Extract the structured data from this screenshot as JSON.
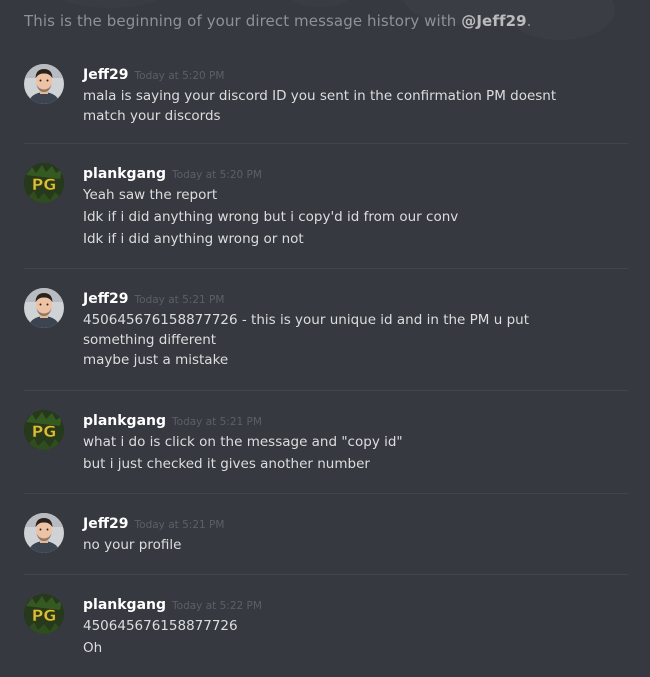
{
  "intro": {
    "prefix": "This is the beginning of your direct message history with ",
    "username": "@Jeff29",
    "suffix": "."
  },
  "messages": [
    {
      "author": "Jeff29",
      "time": "Today at 5:20 PM",
      "avatar": "jeff-avatar",
      "lines": [
        "mala is saying your discord ID you sent in the confirmation PM doesnt match your discords"
      ]
    },
    {
      "author": "plankgang",
      "time": "Today at 5:20 PM",
      "avatar": "pg-avatar",
      "avatar_text": "PG",
      "lines": [
        "Yeah saw the report",
        "Idk if i did anything wrong but i copy'd id from our conv",
        "Idk if i did anything wrong or not"
      ]
    },
    {
      "author": "Jeff29",
      "time": "Today at 5:21 PM",
      "avatar": "jeff-avatar",
      "lines": [
        "450645676158877726 - this is your unique id and in the PM u put something different",
        "maybe just a mistake"
      ]
    },
    {
      "author": "plankgang",
      "time": "Today at 5:21 PM",
      "avatar": "pg-avatar",
      "avatar_text": "PG",
      "lines": [
        "what i do is click on the message and \"copy id\"",
        "but i just checked it gives another number"
      ]
    },
    {
      "author": "Jeff29",
      "time": "Today at 5:21 PM",
      "avatar": "jeff-avatar",
      "lines": [
        "no your profile"
      ]
    },
    {
      "author": "plankgang",
      "time": "Today at 5:22 PM",
      "avatar": "pg-avatar",
      "avatar_text": "PG",
      "lines": [
        "450645676158877726",
        "Oh"
      ]
    }
  ],
  "colors": {
    "background": "#36393f",
    "username": "#ffffff",
    "timestamp": "#5c6066",
    "text": "#dcddde",
    "pg_green": "#2e4a1c",
    "pg_yellow": "#d6c23a"
  }
}
